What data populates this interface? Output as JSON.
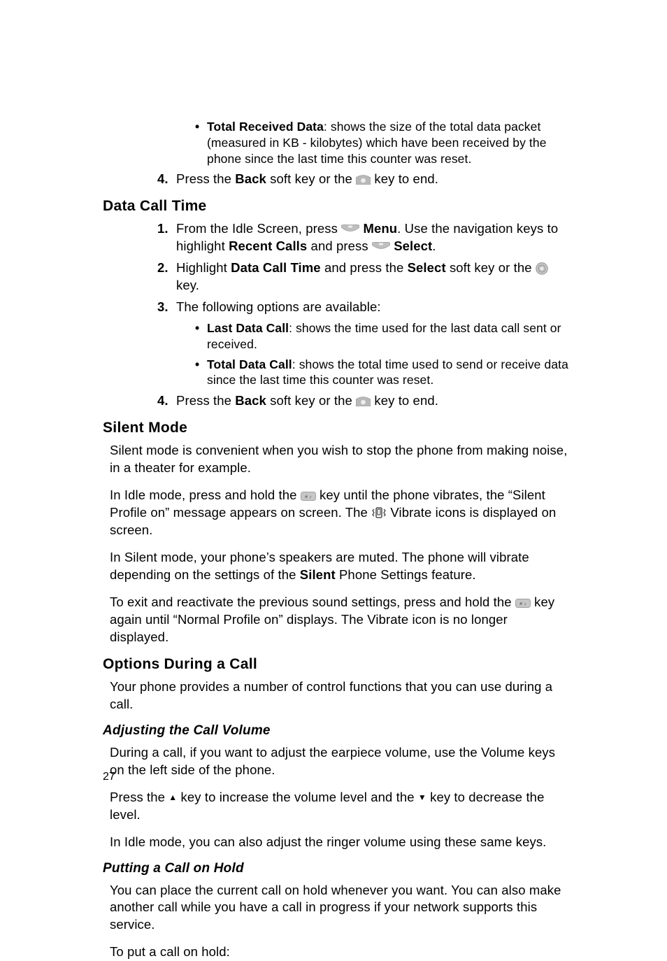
{
  "topBullet": {
    "label": "Total Received Data",
    "text": ": shows the size of the total data packet (measured in KB - kilobytes) which have been received by the phone since the last time this counter was reset."
  },
  "topStep4": {
    "num": "4.",
    "t1": "Press the ",
    "back": "Back",
    "t2": " soft key or the ",
    "t3": " key to end."
  },
  "dct": {
    "heading": "Data Call Time",
    "s1": {
      "num": "1.",
      "t1": "From the Idle Screen, press ",
      "menu": "Menu",
      "t2": ". Use the navigation keys to highlight ",
      "recent": "Recent Calls",
      "t3": " and press ",
      "select": "Select",
      "t4": "."
    },
    "s2": {
      "num": "2.",
      "t1": "Highlight ",
      "dctLabel": "Data Call Time",
      "t2": " and press the ",
      "select": "Select",
      "t3": " soft key or the ",
      "t4": " key."
    },
    "s3": {
      "num": "3.",
      "text": "The following options are available:"
    },
    "b1": {
      "label": "Last Data Call",
      "text": ": shows the time used for the last data call sent or received."
    },
    "b2": {
      "label": "Total Data Call",
      "text": ": shows the total time used to send or receive data since the last time this counter was reset."
    },
    "s4": {
      "num": "4.",
      "t1": "Press the ",
      "back": "Back",
      "t2": " soft key or the ",
      "t3": " key to end."
    }
  },
  "silent": {
    "heading": "Silent Mode",
    "p1": "Silent mode is convenient when you wish to stop the phone from making noise, in a theater for example.",
    "p2a": "In Idle mode, press and hold the ",
    "p2b": " key until the phone vibrates, the “Silent Profile on” message appears on screen. The ",
    "p2c": " Vibrate icons is displayed on screen.",
    "p3a": "In Silent mode, your phone’s speakers are muted. The phone will vibrate depending on the settings of the ",
    "p3bold": "Silent",
    "p3b": " Phone Settings feature.",
    "p4a": "To exit and reactivate the previous sound settings, press and hold the ",
    "p4b": " key again until “Normal Profile on” displays. The Vibrate icon is no longer displayed."
  },
  "options": {
    "heading": "Options During a Call",
    "p1": "Your phone provides a number of control functions that you can use during a call."
  },
  "volume": {
    "heading": "Adjusting the Call Volume",
    "p1": "During a call, if you want to adjust the earpiece volume, use the Volume keys on the left side of the phone.",
    "p2a": "Press the ",
    "up": "▲",
    "p2b": " key to increase the volume level and the ",
    "down": "▼",
    "p2c": " key to decrease the level.",
    "p3": "In Idle mode, you can also adjust the ringer volume using these same keys."
  },
  "hold": {
    "heading": "Putting a Call on Hold",
    "p1": "You can place the current call on hold whenever you want. You can also make another call while you have a call in progress if your network supports this service.",
    "p2": "To put a call on hold:"
  },
  "pageNumber": "27"
}
